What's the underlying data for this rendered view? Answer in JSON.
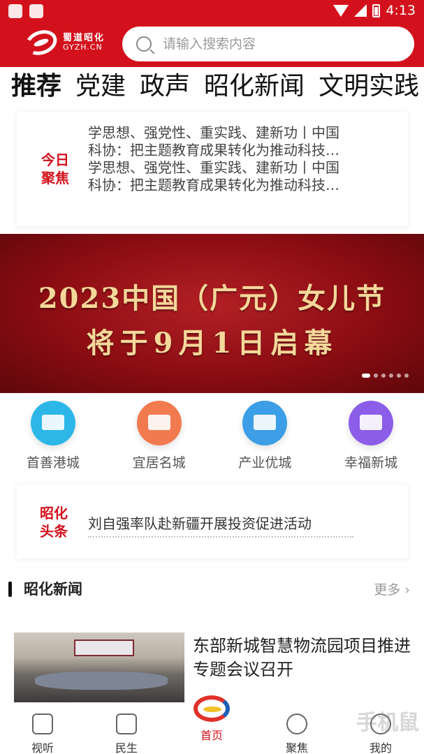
{
  "status_bar": {
    "time": "4:13"
  },
  "header": {
    "logo_cn": "蜀道昭化",
    "logo_en": "GYZH.CN",
    "search_placeholder": "请输入搜索内容"
  },
  "tabs": [
    {
      "label": "推荐",
      "active": true
    },
    {
      "label": "党建"
    },
    {
      "label": "政声"
    },
    {
      "label": "昭化新闻"
    },
    {
      "label": "文明实践"
    }
  ],
  "focus": {
    "label": "今日聚焦",
    "lines": [
      "学思想、强党性、重实践、建新功丨中国",
      "科协：把主题教育成果转化为推动科技…",
      "学思想、强党性、重实践、建新功丨中国",
      "科协：把主题教育成果转化为推动科技…"
    ]
  },
  "banner": {
    "line1": "2023中国（广元）女儿节",
    "line2": "将于9月1日启幕",
    "dot_count": 6,
    "active_dot": 0
  },
  "quick_entries": [
    {
      "label": "首善港城",
      "icon": "ship-icon"
    },
    {
      "label": "宜居名城",
      "icon": "gate-tower-icon"
    },
    {
      "label": "产业优城",
      "icon": "factory-icon"
    },
    {
      "label": "幸福新城",
      "icon": "building-icon"
    }
  ],
  "headline": {
    "label": "昭化头条",
    "text": "刘自强率队赴新疆开展投资促进活动"
  },
  "section": {
    "title": "昭化新闻",
    "more": "更多"
  },
  "news": [
    {
      "title": "东部新城智慧物流园项目推进专题会议召开"
    }
  ],
  "bottom_nav": [
    {
      "label": "视听",
      "icon": "video-icon"
    },
    {
      "label": "民生",
      "icon": "chat-icon"
    },
    {
      "label": "首页",
      "icon": "home-logo-icon",
      "active": true
    },
    {
      "label": "聚焦",
      "icon": "grid-icon"
    },
    {
      "label": "我的",
      "icon": "user-icon"
    }
  ],
  "watermark": "手机鼠"
}
